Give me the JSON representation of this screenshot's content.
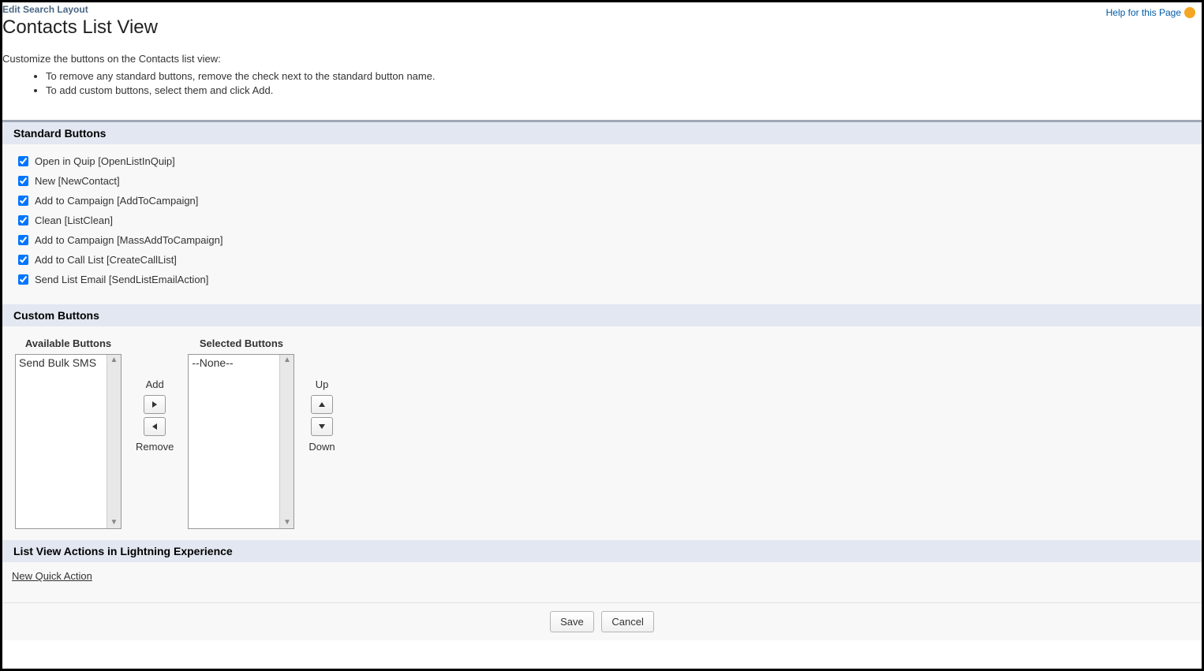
{
  "header": {
    "breadcrumb": "Edit Search Layout",
    "title": "Contacts List View",
    "help_link": "Help for this Page"
  },
  "description": "Customize the buttons on the Contacts list view:",
  "instructions": [
    "To remove any standard buttons, remove the check next to the standard button name.",
    "To add custom buttons, select them and click Add."
  ],
  "sections": {
    "standard": {
      "title": "Standard Buttons",
      "items": [
        "Open in Quip [OpenListInQuip]",
        "New [NewContact]",
        "Add to Campaign [AddToCampaign]",
        "Clean [ListClean]",
        "Add to Campaign [MassAddToCampaign]",
        "Add to Call List [CreateCallList]",
        "Send List Email [SendListEmailAction]"
      ]
    },
    "custom": {
      "title": "Custom Buttons",
      "available_label": "Available Buttons",
      "selected_label": "Selected Buttons",
      "available_items": [
        "Send Bulk SMS"
      ],
      "selected_items": [
        "--None--"
      ],
      "add_label": "Add",
      "remove_label": "Remove",
      "up_label": "Up",
      "down_label": "Down"
    },
    "lightning": {
      "title": "List View Actions in Lightning Experience",
      "link": "New Quick Action"
    }
  },
  "footer": {
    "save": "Save",
    "cancel": "Cancel"
  }
}
